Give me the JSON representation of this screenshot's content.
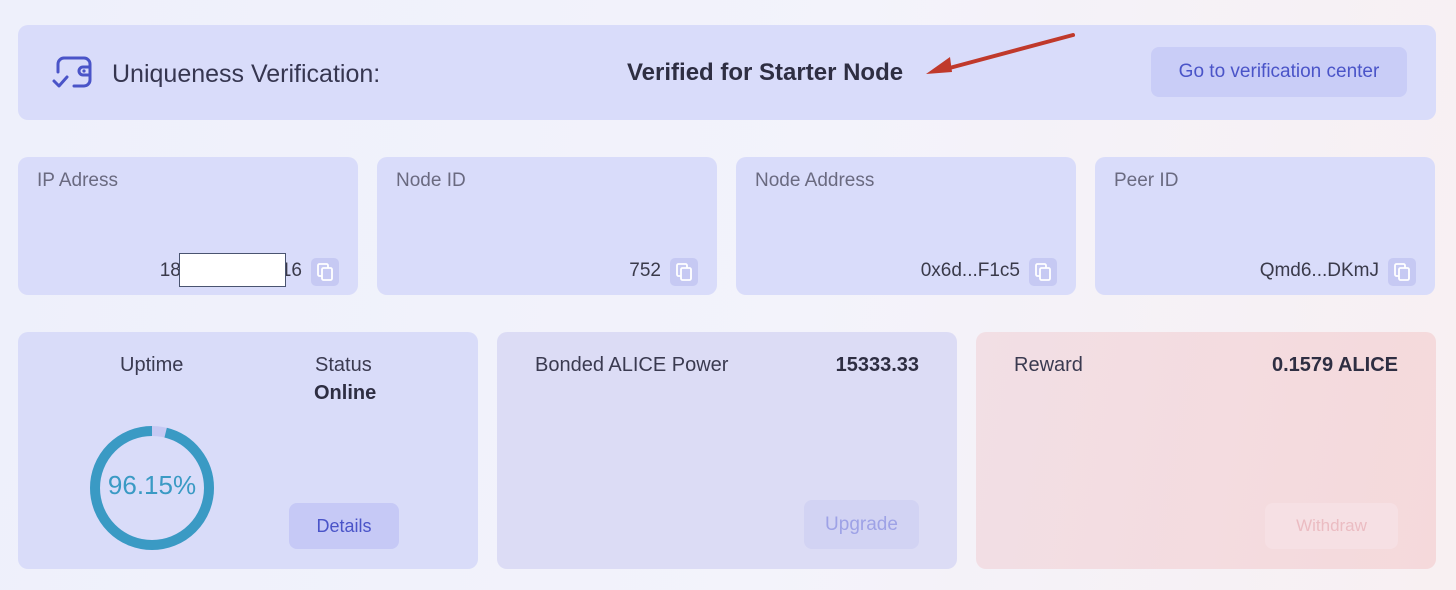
{
  "verification": {
    "label": "Uniqueness Verification:",
    "status": "Verified for Starter Node",
    "button": "Go to verification center"
  },
  "info_cards": [
    {
      "label": "IP Adress",
      "value_prefix": "18",
      "value_suffix": "16"
    },
    {
      "label": "Node ID",
      "value": "752"
    },
    {
      "label": "Node Address",
      "value": "0x6d...F1c5"
    },
    {
      "label": "Peer ID",
      "value": "Qmd6...DKmJ"
    }
  ],
  "uptime": {
    "label": "Uptime",
    "value_text": "96.15%",
    "value": 96.15,
    "status_label": "Status",
    "status_value": "Online",
    "button": "Details"
  },
  "bonded": {
    "label": "Bonded ALICE Power",
    "value": "15333.33",
    "button": "Upgrade"
  },
  "reward": {
    "label": "Reward",
    "value": "0.1579 ALICE",
    "button": "Withdraw"
  },
  "colors": {
    "accent": "#4a54c8",
    "gauge": "#3a9ac4",
    "arrow": "#c0392b"
  }
}
